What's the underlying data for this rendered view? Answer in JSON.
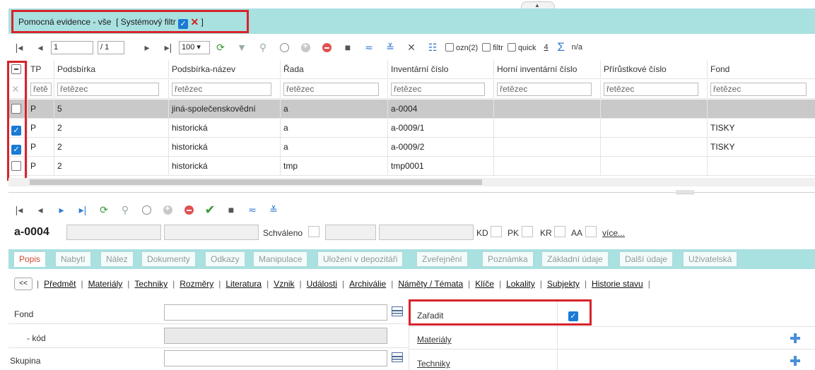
{
  "header": {
    "title": "Pomocná evidence - vše",
    "filter_label": "[ Systémový filtr",
    "filter_close": "]"
  },
  "toolbar": {
    "page_value": "1",
    "page_total": "/ 1",
    "page_size": "100",
    "ozn_label": "ozn(2)",
    "filtr_label": "filtr",
    "quick_label": "quick",
    "count": "4",
    "sum_label": "n/a"
  },
  "grid": {
    "columns": [
      "TP",
      "Podsbírka",
      "Podsbírka-název",
      "Řada",
      "Inventární číslo",
      "Horní inventární číslo",
      "Přírůstkové číslo",
      "Fond"
    ],
    "filter_placeholder": "řetězec",
    "filter_short": "řetě",
    "rows": [
      {
        "checked": false,
        "cells": [
          "P",
          "5",
          "jiná-společenskovědní",
          "a",
          "a-0004",
          "",
          "",
          ""
        ]
      },
      {
        "checked": true,
        "cells": [
          "P",
          "2",
          "historická",
          "a",
          "a-0009/1",
          "",
          "",
          "TISKY"
        ]
      },
      {
        "checked": true,
        "cells": [
          "P",
          "2",
          "historická",
          "a",
          "a-0009/2",
          "",
          "",
          "TISKY"
        ]
      },
      {
        "checked": false,
        "cells": [
          "P",
          "2",
          "historická",
          "tmp",
          "tmp0001",
          "",
          "",
          ""
        ]
      }
    ]
  },
  "detail": {
    "record_id": "a-0004",
    "schvaleno_label": "Schváleno",
    "kd_label": "KD",
    "pk_label": "PK",
    "kr_label": "KR",
    "aa_label": "AA",
    "more_label": "více..."
  },
  "tabs": [
    "Popis",
    "Nabytí",
    "Nález",
    "Dokumenty",
    "Odkazy",
    "Manipulace",
    "Uložení v depozitáři",
    "Zveřejnění",
    "Poznámka",
    "Základní údaje",
    "Další údaje",
    "Uživatelská"
  ],
  "links": {
    "back": "<<",
    "items": [
      "Předmět",
      "Materiály",
      "Techniky",
      "Rozměry",
      "Literatura",
      "Vznik",
      "Události",
      "Archiválie",
      "Náměty / Témata",
      "Klíče",
      "Lokality",
      "Subjekty",
      "Historie stavu"
    ]
  },
  "form": {
    "fond_label": "Fond",
    "kod_label": "- kód",
    "skupina_label": "Skupina",
    "zaradit_label": "Zařadit",
    "materialy_label": "Materiály",
    "techniky_label": "Techniky"
  }
}
